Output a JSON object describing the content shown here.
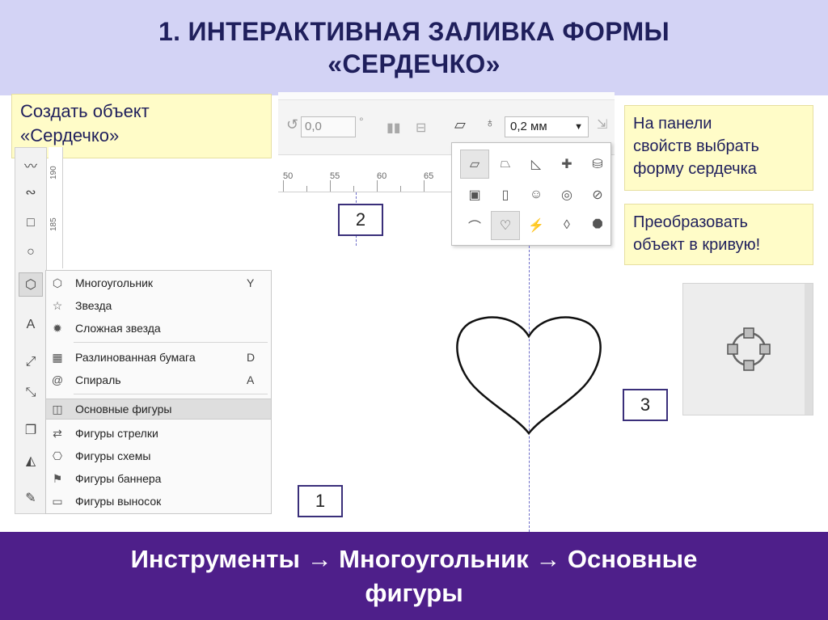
{
  "slide": {
    "title_line1": "1. ИНТЕРАКТИВНАЯ ЗАЛИВКА ФОРМЫ",
    "title_line2": "«СЕРДЕЧКО»",
    "bottom_line1": "Инструменты → Многоугольник → Основные",
    "bottom_line2": "фигуры"
  },
  "notes": {
    "create_line1": "Создать объект",
    "create_line2": "«Сердечко»",
    "panel_line1": "На панели",
    "panel_line2": "свойств выбрать",
    "panel_line3": "форму сердечка",
    "convert_line1": "Преобразовать",
    "convert_line2": "объект в кривую!"
  },
  "propbar": {
    "rotation_value": "0,0",
    "degree_symbol": "°",
    "outline_width": "0,2 мм"
  },
  "ruler": {
    "h_labels": [
      "50",
      "55",
      "60",
      "65"
    ],
    "v_labels": [
      "190",
      "185"
    ]
  },
  "flyout_menu": {
    "items": [
      {
        "label": "Многоугольник",
        "shortcut": "Y"
      },
      {
        "label": "Звезда",
        "shortcut": ""
      },
      {
        "label": "Сложная звезда",
        "shortcut": ""
      },
      {
        "label": "Разлинованная бумага",
        "shortcut": "D"
      },
      {
        "label": "Спираль",
        "shortcut": "A"
      },
      {
        "label": "Основные фигуры",
        "shortcut": ""
      },
      {
        "label": "Фигуры стрелки",
        "shortcut": ""
      },
      {
        "label": "Фигуры схемы",
        "shortcut": ""
      },
      {
        "label": "Фигуры баннера",
        "shortcut": ""
      },
      {
        "label": "Фигуры выносок",
        "shortcut": ""
      }
    ]
  },
  "callouts": {
    "step1": "1",
    "step2": "2",
    "step3": "3"
  },
  "colors": {
    "title_bg": "#d3d3f5",
    "title_text": "#1f1f5c",
    "note_bg": "#fffcc8",
    "bottom_bg": "#4e1f8a",
    "callout_border": "#3a2f7a"
  }
}
